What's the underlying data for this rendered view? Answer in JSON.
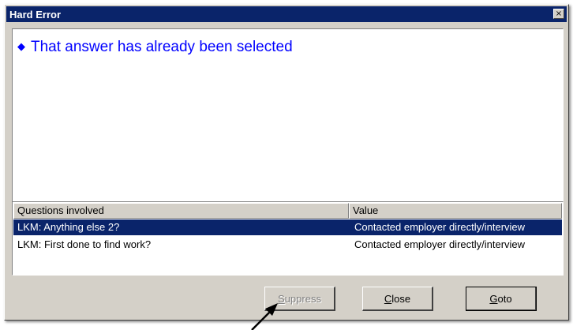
{
  "window": {
    "title": "Hard Error",
    "close_glyph": "×"
  },
  "message": {
    "bullet": "◆",
    "text": "That answer has already been selected",
    "color": "#0000ff"
  },
  "list": {
    "columns": [
      "Questions involved",
      "Value"
    ],
    "rows": [
      {
        "question": "LKM: Anything else 2?",
        "value": "Contacted employer directly/interview",
        "selected": true
      },
      {
        "question": "LKM: First done to find work?",
        "value": "Contacted employer directly/interview",
        "selected": false
      }
    ]
  },
  "buttons": {
    "suppress": {
      "mnemonic": "S",
      "rest": "uppress",
      "enabled": false
    },
    "close": {
      "mnemonic": "C",
      "rest": "lose"
    },
    "goto": {
      "mnemonic": "G",
      "rest": "oto"
    }
  },
  "colors": {
    "titlebar": "#0a246a",
    "dialog_face": "#d4d0c8",
    "selection": "#0a246a"
  }
}
